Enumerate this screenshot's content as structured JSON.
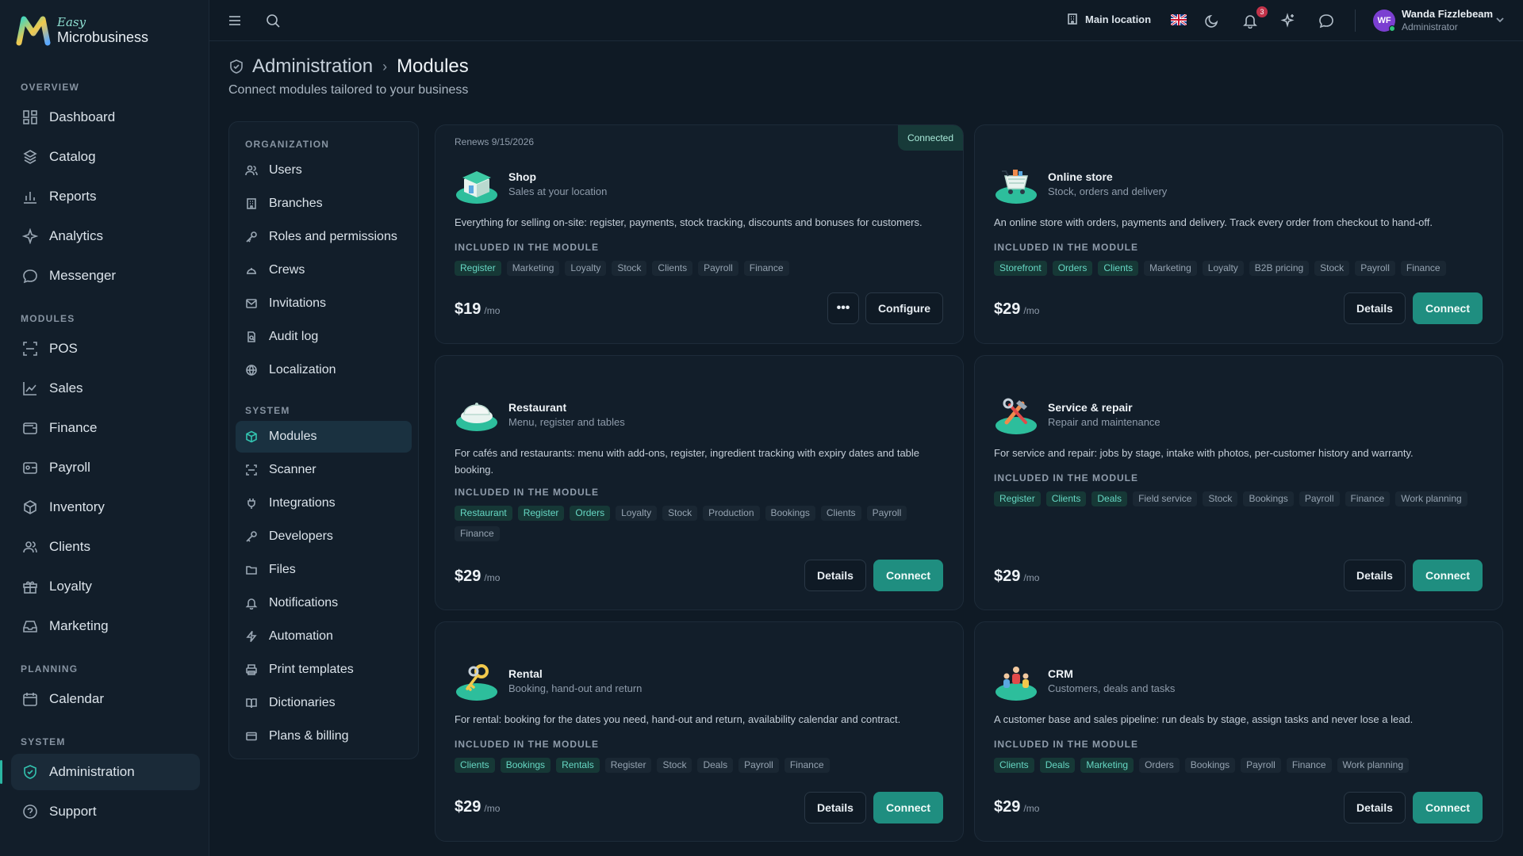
{
  "brand": {
    "easy": "Easy",
    "name": "Microbusiness"
  },
  "sidebar": {
    "sections": {
      "overview": "OVERVIEW",
      "modules": "MODULES",
      "planning": "PLANNING",
      "system": "SYSTEM"
    },
    "items": {
      "dashboard": "Dashboard",
      "catalog": "Catalog",
      "reports": "Reports",
      "analytics": "Analytics",
      "messenger": "Messenger",
      "pos": "POS",
      "sales": "Sales",
      "finance": "Finance",
      "payroll": "Payroll",
      "inventory": "Inventory",
      "clients": "Clients",
      "loyalty": "Loyalty",
      "marketing": "Marketing",
      "calendar": "Calendar",
      "administration": "Administration",
      "support": "Support"
    }
  },
  "topbar": {
    "location": "Main location",
    "notification_count": "3",
    "user": {
      "initials": "WF",
      "name": "Wanda Fizzlebeam",
      "role": "Administrator"
    }
  },
  "header": {
    "section": "Administration",
    "page": "Modules",
    "subtitle": "Connect modules tailored to your business"
  },
  "settings_nav": {
    "organization_label": "ORGANIZATION",
    "system_label": "SYSTEM",
    "items": {
      "users": "Users",
      "branches": "Branches",
      "roles": "Roles and permissions",
      "crews": "Crews",
      "invitations": "Invitations",
      "audit_log": "Audit log",
      "localization": "Localization",
      "modules": "Modules",
      "scanner": "Scanner",
      "integrations": "Integrations",
      "developers": "Developers",
      "files": "Files",
      "notifications": "Notifications",
      "automation": "Automation",
      "print_templates": "Print templates",
      "dictionaries": "Dictionaries",
      "plans_billing": "Plans & billing"
    }
  },
  "labels": {
    "included": "INCLUDED IN THE MODULE",
    "per_month": "/mo",
    "details": "Details",
    "connect": "Connect",
    "configure": "Configure",
    "more": "•••"
  },
  "cards": {
    "shop": {
      "renews": "Renews 9/15/2026",
      "status": "Connected",
      "title": "Shop",
      "subtitle": "Sales at your location",
      "description": "Everything for selling on-site: register, payments, stock tracking, discounts and bonuses for customers.",
      "tags": [
        "Register",
        "Marketing",
        "Loyalty",
        "Stock",
        "Clients",
        "Payroll",
        "Finance"
      ],
      "highlighted": 1,
      "price": "$19"
    },
    "online_store": {
      "title": "Online store",
      "subtitle": "Stock, orders and delivery",
      "description": "An online store with orders, payments and delivery. Track every order from checkout to hand-off.",
      "tags": [
        "Storefront",
        "Orders",
        "Clients",
        "Marketing",
        "Loyalty",
        "B2B pricing",
        "Stock",
        "Payroll",
        "Finance"
      ],
      "highlighted": 3,
      "price": "$29"
    },
    "restaurant": {
      "title": "Restaurant",
      "subtitle": "Menu, register and tables",
      "description": "For cafés and restaurants: menu with add-ons, register, ingredient tracking with expiry dates and table booking.",
      "tags": [
        "Restaurant",
        "Register",
        "Orders",
        "Loyalty",
        "Stock",
        "Production",
        "Bookings",
        "Clients",
        "Payroll",
        "Finance"
      ],
      "highlighted": 3,
      "price": "$29"
    },
    "service": {
      "title": "Service & repair",
      "subtitle": "Repair and maintenance",
      "description": "For service and repair: jobs by stage, intake with photos, per-customer history and warranty.",
      "tags": [
        "Register",
        "Clients",
        "Deals",
        "Field service",
        "Stock",
        "Bookings",
        "Payroll",
        "Finance",
        "Work planning"
      ],
      "highlighted": 3,
      "price": "$29"
    },
    "rental": {
      "title": "Rental",
      "subtitle": "Booking, hand-out and return",
      "description": "For rental: booking for the dates you need, hand-out and return, availability calendar and contract.",
      "tags": [
        "Clients",
        "Bookings",
        "Rentals",
        "Register",
        "Stock",
        "Deals",
        "Payroll",
        "Finance"
      ],
      "highlighted": 3,
      "price": "$29"
    },
    "crm": {
      "title": "CRM",
      "subtitle": "Customers, deals and tasks",
      "description": "A customer base and sales pipeline: run deals by stage, assign tasks and never lose a lead.",
      "tags": [
        "Clients",
        "Deals",
        "Marketing",
        "Orders",
        "Bookings",
        "Payroll",
        "Finance",
        "Work planning"
      ],
      "highlighted": 3,
      "price": "$29"
    }
  }
}
